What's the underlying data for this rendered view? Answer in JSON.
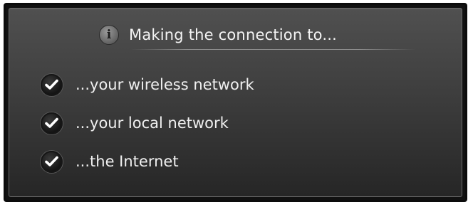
{
  "dialog": {
    "title": "Making the connection to...",
    "icon": "info-icon",
    "items": [
      {
        "label": "...your wireless network",
        "status": "complete",
        "icon": "check-icon"
      },
      {
        "label": "...your local network",
        "status": "complete",
        "icon": "check-icon"
      },
      {
        "label": "...the Internet",
        "status": "complete",
        "icon": "check-icon"
      }
    ]
  },
  "colors": {
    "panel_top": "#505050",
    "panel_bottom": "#262626",
    "text": "#f4f4f4",
    "check_bg": "#141414",
    "check_mark": "#ffffff"
  }
}
